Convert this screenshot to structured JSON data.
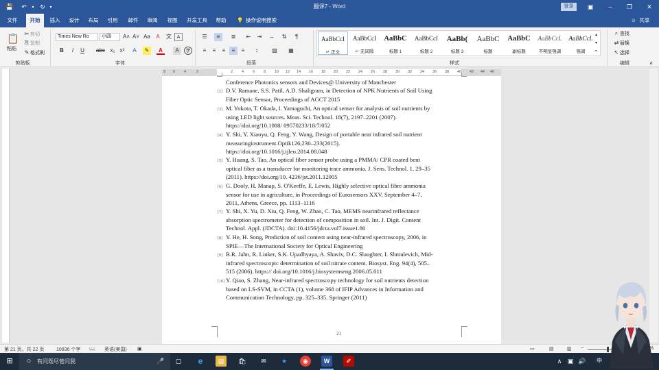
{
  "titlebar": {
    "title": "翻译7 - Word",
    "login": "登录",
    "buttons": [
      "ribbon-display",
      "minimize",
      "maximize",
      "close"
    ]
  },
  "tabs": [
    "文件",
    "开始",
    "插入",
    "设计",
    "布局",
    "引用",
    "邮件",
    "审阅",
    "视图",
    "开发工具",
    "帮助"
  ],
  "tell_me": "操作说明搜索",
  "share": "共享",
  "ribbon": {
    "clipboard": {
      "label": "剪贴板",
      "paste": "粘贴",
      "cut": "剪切",
      "copy": "复制",
      "format_painter": "格式刷"
    },
    "font": {
      "label": "字体",
      "family": "Times New Ro",
      "size": "小四"
    },
    "paragraph": {
      "label": "段落"
    },
    "styles": {
      "label": "样式",
      "items": [
        {
          "sample": "AaBbCcI",
          "name": "↵ 正文"
        },
        {
          "sample": "AaBbCcI",
          "name": "↵ 无间隔"
        },
        {
          "sample": "AaBbC",
          "name": "标题 1"
        },
        {
          "sample": "AaBbCcI",
          "name": "标题 2"
        },
        {
          "sample": "AaBb(",
          "name": "标题 3"
        },
        {
          "sample": "AaBbC",
          "name": "标题"
        },
        {
          "sample": "AaBbC",
          "name": "副标题"
        },
        {
          "sample": "AaBbCcL",
          "name": "不明显强调"
        },
        {
          "sample": "AaBbCcL",
          "name": "强调"
        }
      ]
    },
    "editing": {
      "label": "编辑",
      "find": "查找",
      "replace": "替换",
      "select": "选择"
    }
  },
  "ruler": {
    "ticks": [
      "8",
      "6",
      "4",
      "2",
      "2",
      "4",
      "6",
      "8",
      "10",
      "12",
      "14",
      "16",
      "18",
      "20",
      "22",
      "24",
      "26",
      "28",
      "30",
      "32",
      "34",
      "36",
      "38",
      "40",
      "42",
      "44",
      "46",
      "48"
    ]
  },
  "document": {
    "references": [
      {
        "num": "",
        "lines": [
          "Conference Photonics sensors and Devices@ University of Manchester"
        ]
      },
      {
        "num": "[2]",
        "lines": [
          "D.V. Ramane, S.S. Patil, A.D. Shaligram, in Detection of NPK Nutrients of Soil Using",
          "Fiber Optic Sensor, Proceedings of AGCT 2015"
        ]
      },
      {
        "num": "[3]",
        "lines": [
          "M. Yokota, T. Okada, I. Yamaguchi, An optical sensor for analysis of soil nutrients by",
          "using LED light sources. Meas. Sci. Technol. 18(7), 2197–2201 (2007).",
          "https://doi.org/10.1088/ 09570233/18/7/052"
        ]
      },
      {
        "num": "[4]",
        "lines": [
          "Y. Shi, Y. Xiaoyu, Q. Feng, Y. Wang, Design of portable near infrared soil nutrient",
          "measuringinstrument.Optik126,230–233(2015).",
          "https://doi.org/10.1016/j.ijleo.2014.08.048"
        ]
      },
      {
        "num": "[5]",
        "lines": [
          "Y. Huang, S. Tao, An optical fiber sensor probe using a PMMA/ CPR coated bent",
          "optical fiber as a transducer for monitoring trace ammonia. J. Sens. Technol. 1, 29–35",
          "(2011). https://doi.org/10. 4236/jst.2011.12005"
        ]
      },
      {
        "num": "[6]",
        "lines": [
          "G. Dooly, H. Manap, S. O'Keeffe, E. Lewis, Highly selective optical fibre ammonia",
          "sensor for use in agriculture, in Proceedings of Eurosensors XXV, September 4–7,",
          "2011, Athens, Greece, pp. 1113–1116"
        ]
      },
      {
        "num": "[7]",
        "lines": [
          "Y. Shi, X. Yu, D. Xiu, Q. Feng, W. Zhao, C. Tao, MEMS nearinfrared reflectance",
          "absorption spectrometer for detection of composition in soil. Int. J. Digit. Content",
          "Technol. Appl. (JDCTA). doi:10.4156/jdcta.vol7.issue1.80"
        ]
      },
      {
        "num": "[8]",
        "lines": [
          "Y. He, H. Song, Prediction of soil content using near-infrared spectroscopy, 2006, in",
          "SPIE—The International Society for Optical Engineering"
        ]
      },
      {
        "num": "[9]",
        "lines": [
          "B.R. Jahn, R. Linker, S.K. Upadhyaya, A. Shaviv, D.C. Slaughter, I. Shmulevich, Mid-",
          "infrared spectroscopic determination of soil nitrate content. Biosyst. Eng. 94(4), 505–",
          "515 (2006). https:// doi.org/10.1016/j.biosystemseng.2006.05.011"
        ]
      },
      {
        "num": "[10]",
        "lines": [
          "Y. Qiao, S. Zhang, Near-infrared spectroscopy technology for soil nutrients detection",
          "based on LS-SVM, in CCTA (1), volume 368 of IFIP Advances in Information and",
          "Communication Technology, pp. 325–335. Springer (2011)"
        ]
      }
    ],
    "page_number": "21"
  },
  "statusbar": {
    "page": "第 21 页，共 22 页",
    "words": "10836 个字",
    "language": "英语(美国)",
    "zoom": "%"
  },
  "taskbar": {
    "search_placeholder": "有问题尽管问我",
    "tray_text": "中"
  },
  "colors": {
    "word_blue": "#2b579a",
    "taskbar": "#1d2b3a"
  }
}
